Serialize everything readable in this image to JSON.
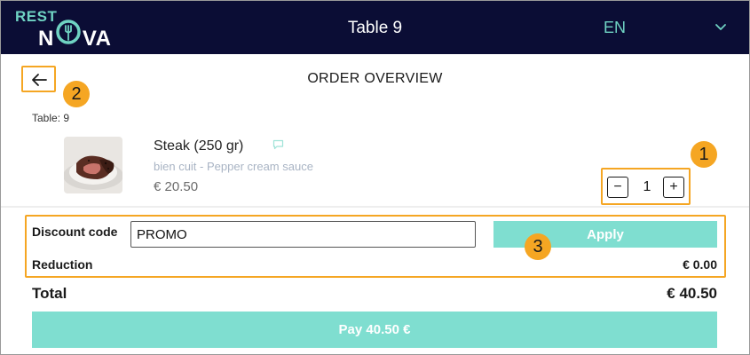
{
  "header": {
    "logo_top": "REST",
    "logo_bottom_left": "N",
    "logo_bottom_right": "VA",
    "table_title": "Table 9",
    "language": "EN"
  },
  "order": {
    "title": "ORDER OVERVIEW",
    "table_label": "Table: 9"
  },
  "callouts": [
    "1",
    "2",
    "3"
  ],
  "item": {
    "name": "Steak (250 gr)",
    "options": "bien cuit - Pepper cream sauce",
    "price": "€ 20.50",
    "quantity": "1",
    "minus_label": "−",
    "plus_label": "+"
  },
  "discount": {
    "label": "Discount code",
    "value": "PROMO",
    "apply_label": "Apply",
    "reduction_label": "Reduction",
    "reduction_value": "€ 0.00"
  },
  "summary": {
    "total_label": "Total",
    "total_value": "€ 40.50",
    "pay_label": "Pay 40.50 €"
  },
  "colors": {
    "header_bg": "#0b0d35",
    "accent": "#7fded0",
    "brand_teal": "#6fd3c3",
    "highlight": "#f5a623"
  },
  "icons": [
    "logo-fork-icon",
    "chevron-down-icon",
    "back-arrow-icon",
    "comment-icon",
    "steak-image"
  ]
}
